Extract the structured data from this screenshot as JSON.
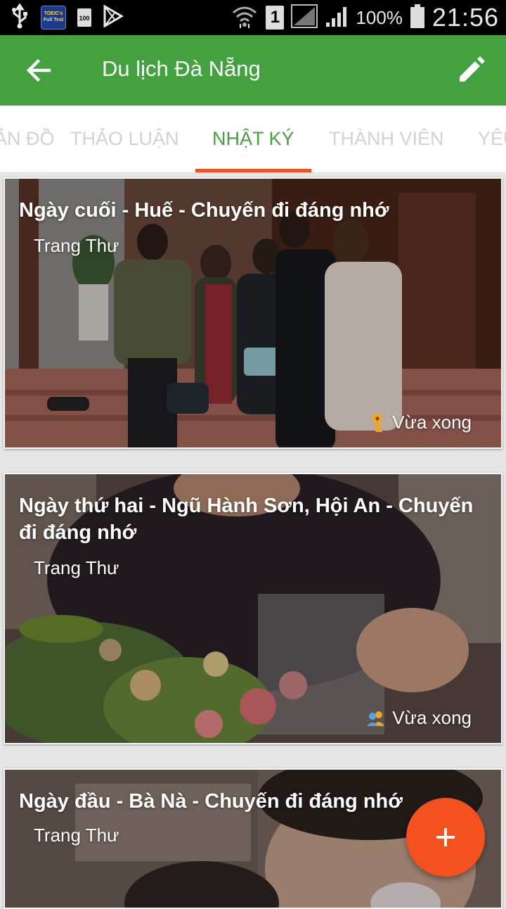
{
  "status_bar": {
    "left_icons": [
      "usb-icon",
      "toeic-app-icon",
      "battery-100-icon",
      "play-store-icon"
    ],
    "toeic_label": "TOEIC's Full Test",
    "small_battery_label": "100",
    "sim_slot": "1",
    "battery_percent": "100%",
    "time": "21:56"
  },
  "app_bar": {
    "title": "Du lịch Đà Nẵng",
    "back_icon": "arrow-back-icon",
    "edit_icon": "pencil-icon"
  },
  "tabs": {
    "items": [
      {
        "label": "BẢN ĐỒ"
      },
      {
        "label": "THẢO LUẬN"
      },
      {
        "label": "NHẬT KÝ"
      },
      {
        "label": "THÀNH VIÊN"
      },
      {
        "label": "YÊU THÍCH"
      }
    ],
    "active_index": 2
  },
  "diary": {
    "entries": [
      {
        "title": "Ngày cuối - Huế - Chuyến đi đáng nhớ",
        "author": "Trang Thư",
        "status": "Vừa xong",
        "status_icon": "key-icon"
      },
      {
        "title": "Ngày thứ hai - Ngũ Hành Sơn, Hội An - Chuyến đi đáng nhớ",
        "author": "Trang Thư",
        "status": "Vừa xong",
        "status_icon": "group-icon"
      },
      {
        "title": "Ngày đầu - Bà Nà - Chuyến đi đáng nhớ",
        "author": "Trang Thư"
      }
    ]
  },
  "fab": {
    "icon": "plus-icon"
  },
  "colors": {
    "primary": "#43a140",
    "accent": "#f4511e",
    "inactive_tab": "#d2d2d2",
    "card_text": "#ffffff"
  }
}
